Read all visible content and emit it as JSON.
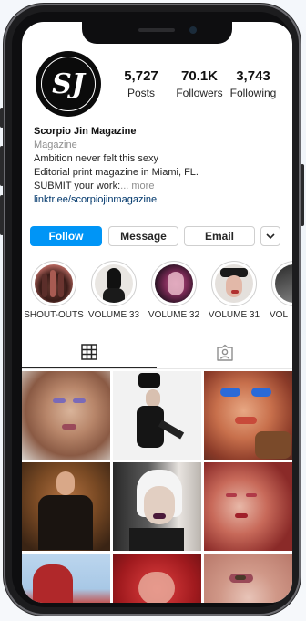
{
  "profile": {
    "posts_count": "5,727",
    "posts_label": "Posts",
    "followers_count": "70.1K",
    "followers_label": "Followers",
    "following_count": "3,743",
    "following_label": "Following",
    "avatar_text": "SJ"
  },
  "bio": {
    "name": "Scorpio Jin Magazine",
    "category": "Magazine",
    "line1": "Ambition never felt this sexy",
    "line2": "Editorial print magazine in Miami, FL.",
    "line3": "SUBMIT your work:",
    "more": "... more",
    "link": "linktr.ee/scorpiojinmagazine"
  },
  "actions": {
    "follow": "Follow",
    "message": "Message",
    "email": "Email"
  },
  "highlights": [
    {
      "label": "SHOUT-OUTS"
    },
    {
      "label": "VOLUME 33"
    },
    {
      "label": "VOLUME 32"
    },
    {
      "label": "VOLUME 31"
    },
    {
      "label": "VOL"
    }
  ],
  "tabs": {
    "grid_icon": "grid-icon",
    "tagged_icon": "tagged-person-icon"
  },
  "colors": {
    "accent": "#0095f6",
    "link": "#00376b",
    "phone_frame": "#1c1c1e"
  }
}
